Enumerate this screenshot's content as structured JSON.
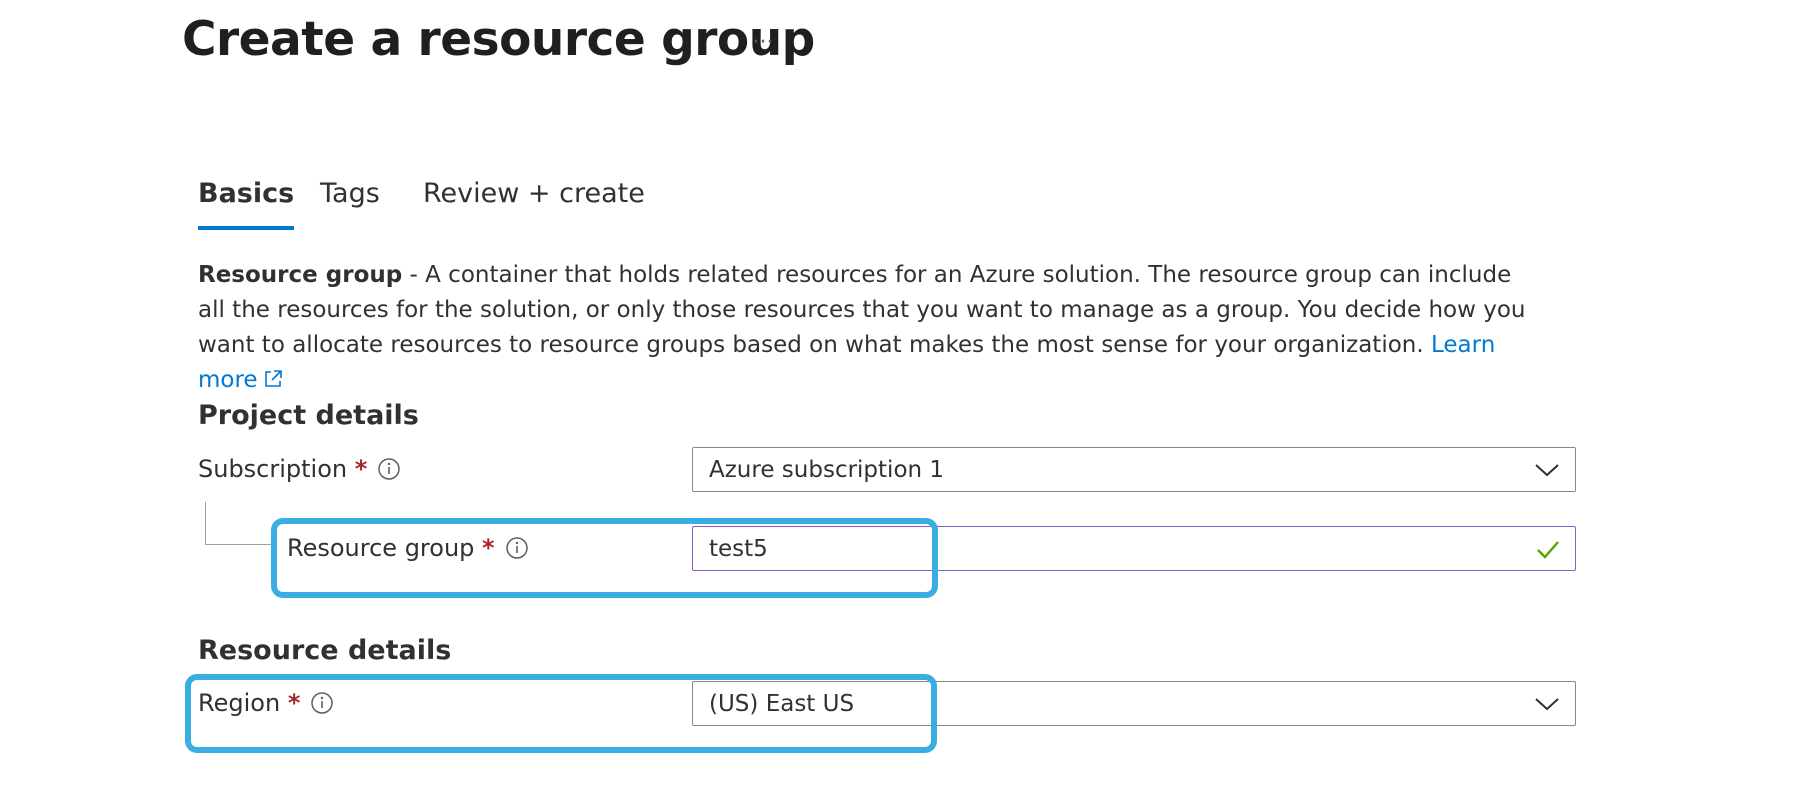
{
  "header": {
    "title": "Create a resource group",
    "more_label": "···"
  },
  "tabs": [
    {
      "label": "Basics",
      "active": true
    },
    {
      "label": "Tags",
      "active": false
    },
    {
      "label": "Review + create",
      "active": false
    }
  ],
  "description": {
    "bold": "Resource group",
    "text": " - A container that holds related resources for an Azure solution. The resource group can include all the resources for the solution, or only those resources that you want to manage as a group. You decide how you want to allocate resources to resource groups based on what makes the most sense for your organization. ",
    "link": "Learn more"
  },
  "project_details": {
    "title": "Project details",
    "subscription": {
      "label": "Subscription",
      "required": "*",
      "value": "Azure subscription 1"
    },
    "resource_group": {
      "label": "Resource group",
      "required": "*",
      "value": "test5"
    }
  },
  "resource_details": {
    "title": "Resource details",
    "region": {
      "label": "Region",
      "required": "*",
      "value": "(US) East US"
    }
  },
  "icons": {
    "more": "ellipsis-icon",
    "info": "info-icon",
    "dropdown": "chevron-down-icon",
    "valid": "checkmark-icon",
    "external": "external-link-icon"
  },
  "colors": {
    "accent": "#0078d4",
    "required": "#a4262c",
    "valid": "#57a300",
    "input_focus": "#8a5dc4",
    "highlight": "#3aaee3"
  }
}
